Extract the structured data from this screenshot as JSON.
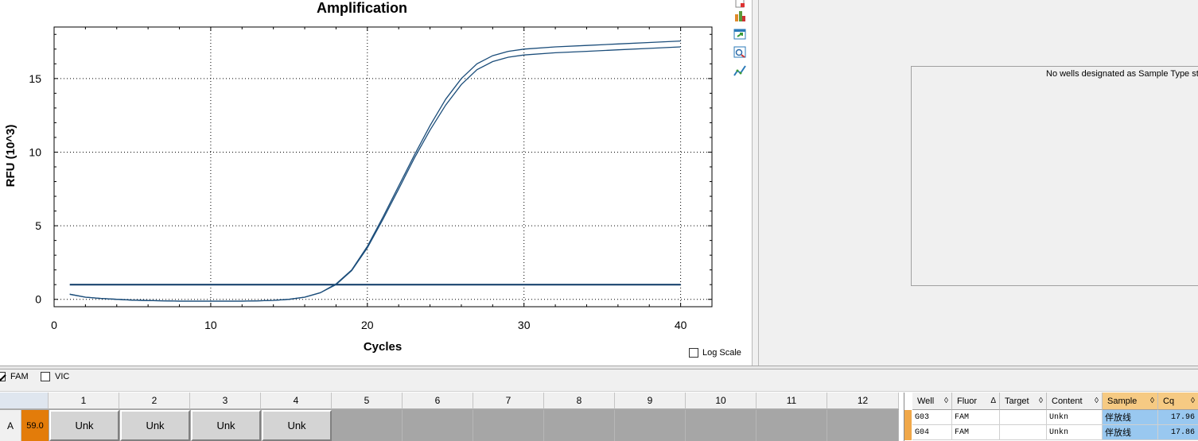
{
  "chart": {
    "title": "Amplification",
    "xlabel": "Cycles",
    "ylabel": "RFU (10^3)",
    "log_scale_label": "Log Scale",
    "log_scale_checked": false
  },
  "chart_data": {
    "type": "line",
    "title": "Amplification",
    "xlabel": "Cycles",
    "ylabel": "RFU (10^3)",
    "xlim": [
      0,
      42
    ],
    "ylim": [
      -0.5,
      18.5
    ],
    "xticks": [
      0,
      10,
      20,
      30,
      40
    ],
    "yticks": [
      0,
      5,
      10,
      15
    ],
    "grid": true,
    "threshold": 1.0,
    "series": [
      {
        "x": [
          1,
          2,
          3,
          4,
          5,
          6,
          7,
          8,
          9,
          10,
          11,
          12,
          13,
          14,
          15,
          16,
          17,
          18,
          19,
          20,
          21,
          22,
          23,
          24,
          25,
          26,
          27,
          28,
          29,
          30,
          32,
          34,
          36,
          38,
          40
        ],
        "values": [
          0.35,
          0.15,
          0.06,
          0.0,
          -0.05,
          -0.08,
          -0.1,
          -0.12,
          -0.12,
          -0.12,
          -0.12,
          -0.12,
          -0.1,
          -0.07,
          0.0,
          0.15,
          0.45,
          1.05,
          2.0,
          3.6,
          5.6,
          7.7,
          9.8,
          11.8,
          13.6,
          15.0,
          16.0,
          16.55,
          16.85,
          17.0,
          17.15,
          17.25,
          17.35,
          17.45,
          17.55
        ]
      },
      {
        "x": [
          1,
          2,
          3,
          4,
          5,
          6,
          7,
          8,
          9,
          10,
          11,
          12,
          13,
          14,
          15,
          16,
          17,
          18,
          19,
          20,
          21,
          22,
          23,
          24,
          25,
          26,
          27,
          28,
          29,
          30,
          32,
          34,
          36,
          38,
          40
        ],
        "values": [
          0.35,
          0.15,
          0.06,
          0.0,
          -0.05,
          -0.08,
          -0.1,
          -0.12,
          -0.12,
          -0.12,
          -0.12,
          -0.12,
          -0.1,
          -0.07,
          0.0,
          0.15,
          0.45,
          1.0,
          1.95,
          3.5,
          5.45,
          7.5,
          9.6,
          11.5,
          13.2,
          14.6,
          15.6,
          16.15,
          16.45,
          16.6,
          16.75,
          16.85,
          16.95,
          17.05,
          17.15
        ]
      }
    ]
  },
  "toolbar": {
    "icons": [
      "document-icon",
      "chart-bar-icon",
      "export-icon",
      "zoom-icon",
      "line-chart-icon"
    ]
  },
  "right_panel": {
    "standard_curve_message": "No wells designated as Sample Type sta"
  },
  "fluors": [
    {
      "label": "FAM",
      "checked": true
    },
    {
      "label": "VIC",
      "checked": false
    }
  ],
  "plate": {
    "columns": [
      "1",
      "2",
      "3",
      "4",
      "5",
      "6",
      "7",
      "8",
      "9",
      "10",
      "11",
      "12"
    ],
    "row_label": "A",
    "row_temp": "59.0",
    "cells": [
      "Unk",
      "Unk",
      "Unk",
      "Unk",
      "",
      "",
      "",
      "",
      "",
      "",
      "",
      ""
    ]
  },
  "well_table": {
    "headers": [
      {
        "label": "Well",
        "sort": "◊"
      },
      {
        "label": "Fluor",
        "sort": "Δ"
      },
      {
        "label": "Target",
        "sort": "◊"
      },
      {
        "label": "Content",
        "sort": "◊"
      },
      {
        "label": "Sample",
        "sort": "◊"
      },
      {
        "label": "Cq",
        "sort": "◊"
      }
    ],
    "rows": [
      {
        "well": "G03",
        "fluor": "FAM",
        "target": "",
        "content": "Unkn",
        "sample": "伴放线",
        "cq": "17.96"
      },
      {
        "well": "G04",
        "fluor": "FAM",
        "target": "",
        "content": "Unkn",
        "sample": "伴放线",
        "cq": "17.86"
      }
    ]
  },
  "colors": {
    "curve": "#1b4d7a",
    "threshold": "#0b3866",
    "temp_cell": "#e37c0a",
    "selected_cell": "#99c8f0",
    "sorted_header": "#f6ca83"
  }
}
